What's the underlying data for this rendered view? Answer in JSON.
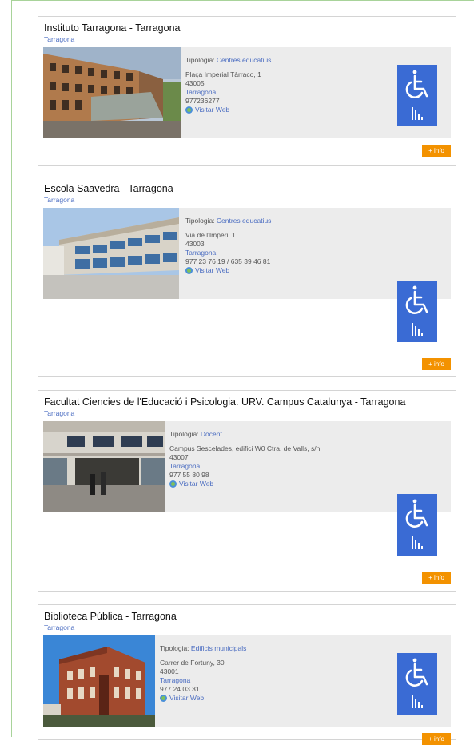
{
  "icons": {
    "accessibility": "wheelchair-icon",
    "signal": "signal-bars-icon",
    "web": "globe-icon"
  },
  "colors": {
    "link": "#4a6cc1",
    "accessibility_badge": "#3a6bd4",
    "info_button": "#f39200",
    "panel_background": "#ececec"
  },
  "cards": [
    {
      "title": "Instituto Tarragona - Tarragona",
      "city": "Tarragona",
      "typology_label": "Tipologia:",
      "typology": "Centres educatius",
      "address": "Plaça Imperial Tàrraco, 1",
      "postal_code": "43005",
      "locality": "Tarragona",
      "phone": "977236277",
      "web_label": "Visitar Web",
      "info_label": "+ info"
    },
    {
      "title": "Escola Saavedra - Tarragona",
      "city": "Tarragona",
      "typology_label": "Tipologia:",
      "typology": "Centres educatius",
      "address": "Via de l'Imperi, 1",
      "postal_code": "43003",
      "locality": "Tarragona",
      "phone": "977 23 76 19 / 635 39 46 81",
      "web_label": "Visitar Web",
      "info_label": "+ info"
    },
    {
      "title": "Facultat Ciencies de l'Educació i Psicologia. URV. Campus Catalunya - Tarragona",
      "city": "Tarragona",
      "typology_label": "Tipologia:",
      "typology": "Docent",
      "address": "Campus Sescelades, edifici W0 Ctra. de Valls, s/n",
      "postal_code": "43007",
      "locality": "Tarragona",
      "phone": "977 55 80 98",
      "web_label": "Visitar Web",
      "info_label": "+ info"
    },
    {
      "title": "Biblioteca Pública - Tarragona",
      "city": "Tarragona",
      "typology_label": "Tipologia:",
      "typology": "Edificis municipals",
      "address": "Carrer de Fortuny, 30",
      "postal_code": "43001",
      "locality": "Tarragona",
      "phone": "977 24 03 31",
      "web_label": "Visitar Web",
      "info_label": "+ info"
    }
  ]
}
